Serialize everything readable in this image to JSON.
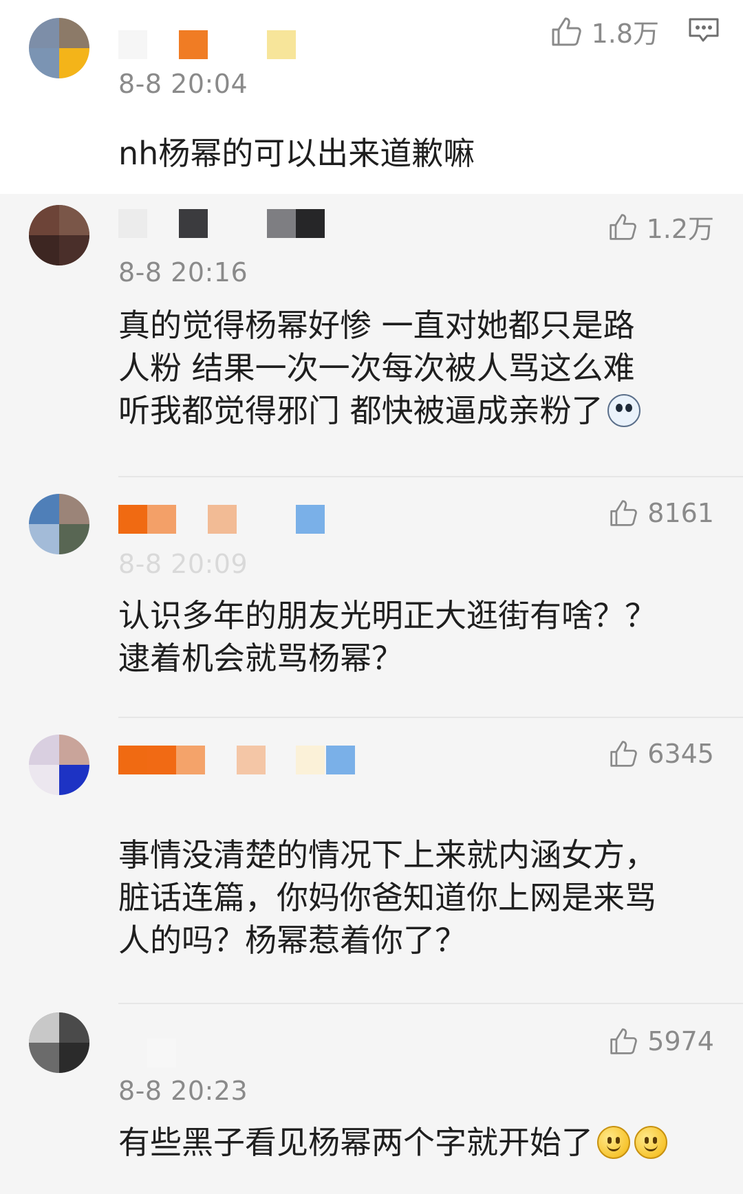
{
  "comments": [
    {
      "timestamp": "8-8 20:04",
      "likes": "1.8万",
      "text_lines": [
        "nh杨幂的可以出来道歉嘛"
      ]
    },
    {
      "timestamp": "8-8 20:16",
      "likes": "1.2万",
      "text_lines": [
        "真的觉得杨幂好惨 一直对她都只是路",
        "人粉 结果一次一次每次被人骂这么难",
        "听我都觉得邪门 都快被逼成亲粉了"
      ],
      "trailing_emoji": "husky-emoji"
    },
    {
      "timestamp": "8-8 20:09",
      "likes": "8161",
      "text_lines": [
        "认识多年的朋友光明正大逛街有啥？？",
        "逮着机会就骂杨幂？"
      ]
    },
    {
      "timestamp": "",
      "likes": "6345",
      "text_lines": [
        "事情没清楚的情况下上来就内涵女方，",
        "脏话连篇，你妈你爸知道你上网是来骂",
        "人的吗？杨幂惹着你了？"
      ]
    },
    {
      "timestamp": "8-8 20:23",
      "likes": "5974",
      "text_lines": [
        "有些黑子看见杨幂两个字就开始了"
      ],
      "trailing_emoji": "smile-emoji"
    }
  ],
  "icons": {
    "like": "thumbs-up-icon",
    "more": "comment-menu-icon"
  },
  "colors": {
    "timestamp": "#8a8a8a",
    "text": "#1f1f1f",
    "divider": "#e6e6e6",
    "background": "#f5f5f5"
  }
}
